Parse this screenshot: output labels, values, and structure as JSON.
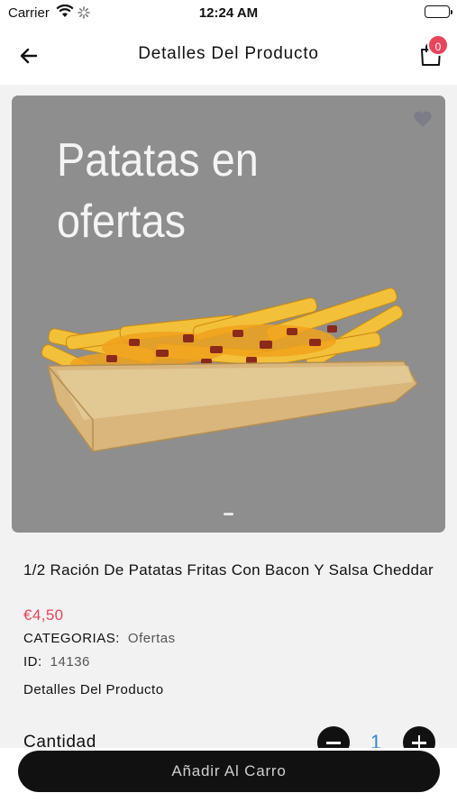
{
  "status_bar": {
    "carrier": "Carrier",
    "time": "12:24 AM"
  },
  "nav": {
    "title": "Detalles Del Producto",
    "cart_count": "0"
  },
  "banner": {
    "text": "Patatas en ofertas",
    "page_count": 1,
    "current_page": 1
  },
  "product": {
    "name": "1/2 Ración De Patatas Fritas Con Bacon Y Salsa Cheddar",
    "price": "€4,50",
    "category_label": "CATEGORIAS:",
    "category_value": "Ofertas",
    "id_label": "ID:",
    "id_value": "14136",
    "details_label": "Detalles Del Producto"
  },
  "quantity": {
    "label": "Cantidad",
    "value": "1"
  },
  "cta": {
    "label": "Añadir Al Carro"
  },
  "colors": {
    "accent": "#e8455c",
    "qty_value": "#2f86d8",
    "button_bg": "#111111",
    "image_bg": "#8e8e8e"
  },
  "icons": {
    "back": "arrow-left-icon",
    "cart": "shopping-bag-icon",
    "favorite": "heart-icon",
    "minus": "minus-icon",
    "plus": "plus-icon"
  }
}
